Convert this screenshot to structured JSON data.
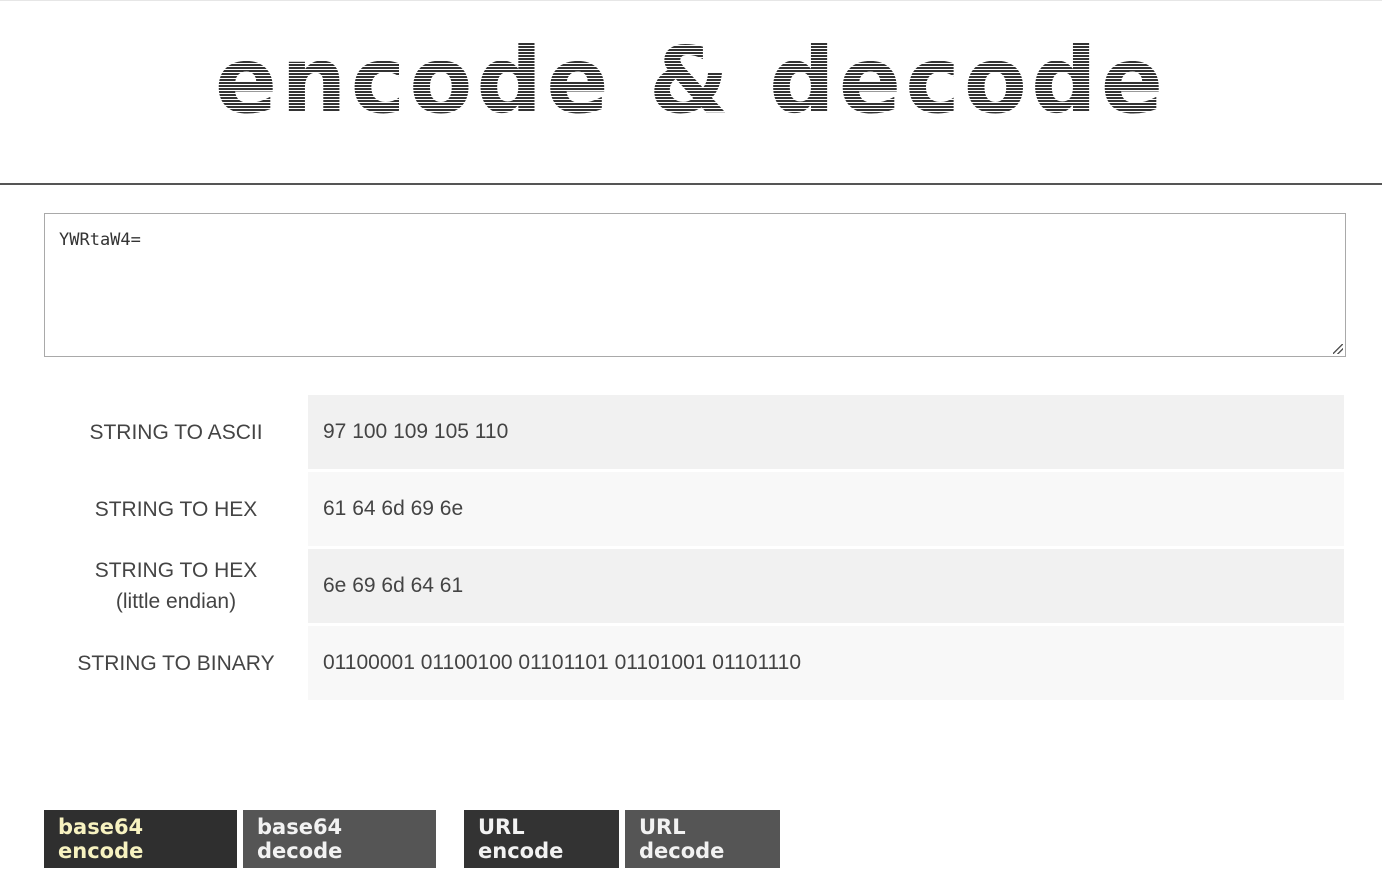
{
  "header": {
    "title": "encode & decode"
  },
  "input": {
    "value": "YWRtaW4="
  },
  "results": [
    {
      "label": "STRING TO ASCII",
      "sublabel": "",
      "value": "97 100 109 105 110"
    },
    {
      "label": "STRING TO HEX",
      "sublabel": "",
      "value": "61 64 6d 69 6e"
    },
    {
      "label": "STRING TO HEX",
      "sublabel": "(little endian)",
      "value": "6e 69 6d 64 61"
    },
    {
      "label": "STRING TO BINARY",
      "sublabel": "",
      "value": "01100001 01100100 01101101 01101001 01101110"
    }
  ],
  "buttons": {
    "base64_encode": "base64 encode",
    "base64_decode": "base64 decode",
    "url_encode": "URL encode",
    "url_decode": "URL decode"
  },
  "colors": {
    "active_button_text": "#f7f2c0",
    "button_dark": "#2f2f2f",
    "button_mid": "#555555"
  }
}
